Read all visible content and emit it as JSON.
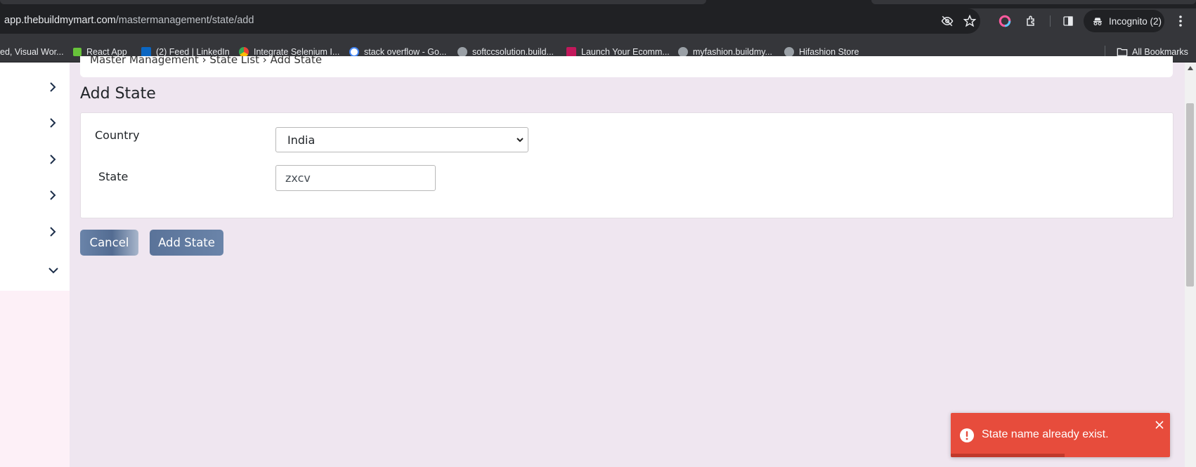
{
  "browser": {
    "url_host": "app.thebuildmymart.com",
    "url_path": "/mastermanagement/state/add",
    "incognito_label": "Incognito (2)",
    "bookmarks": [
      {
        "label": "ed, Visual Wor...",
        "icon": "page-icon",
        "color": "#888888"
      },
      {
        "label": "React App",
        "icon": "react-icon",
        "color": "#67c23a"
      },
      {
        "label": "(2) Feed | LinkedIn",
        "icon": "linkedin-icon",
        "color": "#0a66c2"
      },
      {
        "label": "Integrate Selenium I...",
        "icon": "chrome-icon",
        "color": "#f4b400"
      },
      {
        "label": "stack overflow - Go...",
        "icon": "google-icon",
        "color": "#4285f4"
      },
      {
        "label": "softccsolution.build...",
        "icon": "globe-icon",
        "color": "#9aa0a6"
      },
      {
        "label": "Launch Your Ecomm...",
        "icon": "store-icon",
        "color": "#c2185b"
      },
      {
        "label": "myfashion.buildmy...",
        "icon": "globe-icon",
        "color": "#9aa0a6"
      },
      {
        "label": "Hifashion Store",
        "icon": "globe-icon",
        "color": "#9aa0a6"
      }
    ],
    "all_bookmarks_label": "All Bookmarks"
  },
  "page": {
    "breadcrumb": "Master Management  ›  State List  ›  Add State",
    "title": "Add State",
    "form": {
      "country_label": "Country",
      "country_value": "India",
      "state_label": "State",
      "state_value": "zxcv"
    },
    "buttons": {
      "cancel": "Cancel",
      "add": "Add State"
    }
  },
  "toast": {
    "message": "State name already exist.",
    "type": "error",
    "color": "#e74c3c",
    "progress_fraction": 0.52
  },
  "colors": {
    "page_bg": "#efe6f0",
    "button": "#5f779d"
  }
}
